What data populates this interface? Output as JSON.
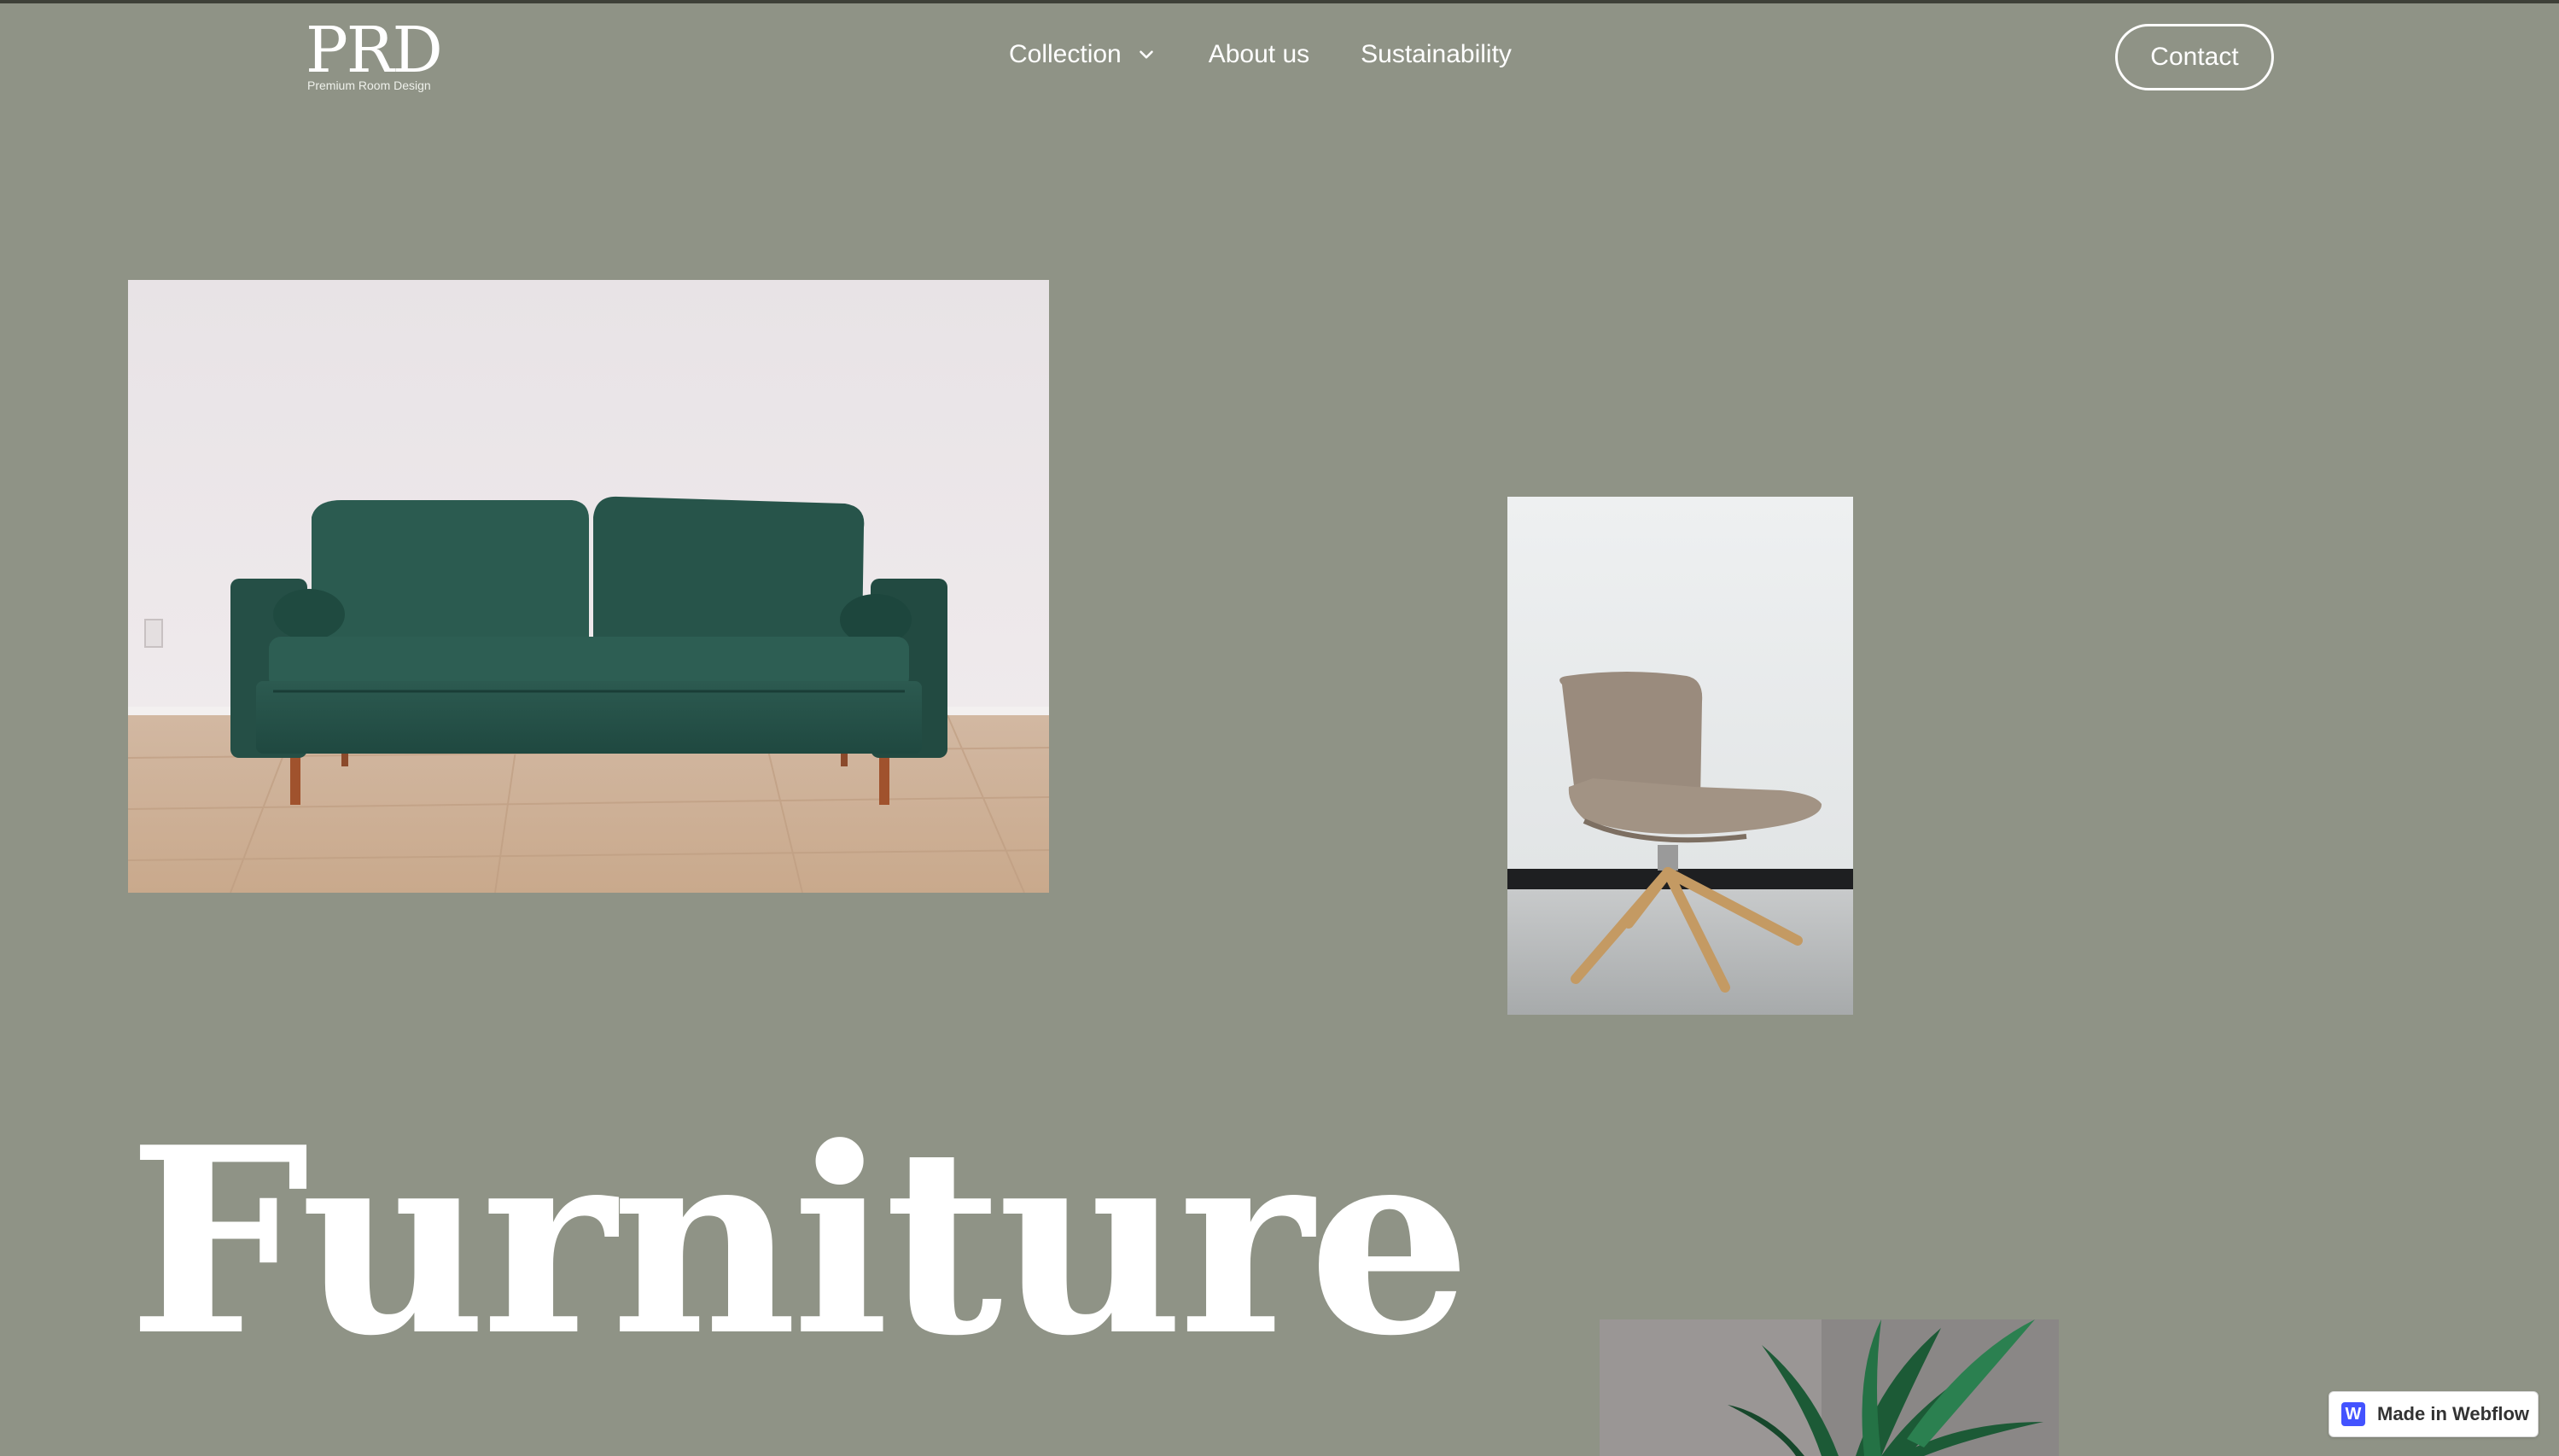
{
  "header": {
    "logo_mark": "PRD",
    "logo_sub": "Premium Room Design",
    "nav": [
      {
        "label": "Collection",
        "icon": "chevron-down-icon"
      },
      {
        "label": "About us"
      },
      {
        "label": "Sustainability"
      }
    ],
    "contact_label": "Contact"
  },
  "hero": {
    "headline": "Furniture",
    "images": [
      {
        "name": "green velvet sofa"
      },
      {
        "name": "beige lounge chair"
      },
      {
        "name": "potted palm plant"
      }
    ]
  },
  "badge": {
    "logo_letter": "W",
    "label": "Made in Webflow"
  },
  "colors": {
    "background": "#8f9386",
    "text": "#ffffff",
    "webflow_blue": "#4353ff"
  }
}
